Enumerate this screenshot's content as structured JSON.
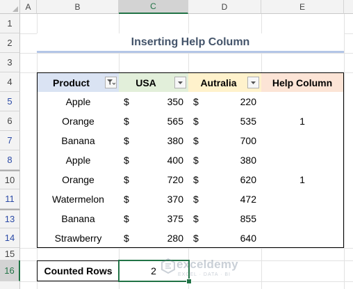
{
  "columns": [
    "A",
    "B",
    "C",
    "D",
    "E"
  ],
  "selected_column": "C",
  "rows": [
    "1",
    "2",
    "3",
    "4",
    "5",
    "6",
    "7",
    "8",
    "10",
    "11",
    "13",
    "14",
    "15",
    "16"
  ],
  "selected_row": "16",
  "title": "Inserting Help Column",
  "headers": {
    "product": "Product",
    "usa": "USA",
    "australia": "Autralia",
    "help": "Help Column"
  },
  "data_rows": [
    {
      "product": "Apple",
      "usa_cur": "$",
      "usa": "350",
      "aus_cur": "$",
      "aus": "220",
      "help": ""
    },
    {
      "product": "Orange",
      "usa_cur": "$",
      "usa": "565",
      "aus_cur": "$",
      "aus": "535",
      "help": "1"
    },
    {
      "product": "Banana",
      "usa_cur": "$",
      "usa": "380",
      "aus_cur": "$",
      "aus": "700",
      "help": ""
    },
    {
      "product": "Apple",
      "usa_cur": "$",
      "usa": "400",
      "aus_cur": "$",
      "aus": "380",
      "help": ""
    },
    {
      "product": "Orange",
      "usa_cur": "$",
      "usa": "720",
      "aus_cur": "$",
      "aus": "620",
      "help": "1"
    },
    {
      "product": "Watermelon",
      "usa_cur": "$",
      "usa": "370",
      "aus_cur": "$",
      "aus": "472",
      "help": ""
    },
    {
      "product": "Banana",
      "usa_cur": "$",
      "usa": "375",
      "aus_cur": "$",
      "aus": "855",
      "help": ""
    },
    {
      "product": "Strawberry",
      "usa_cur": "$",
      "usa": "280",
      "aus_cur": "$",
      "aus": "640",
      "help": ""
    }
  ],
  "counted": {
    "label": "Counted Rows",
    "value": "2"
  },
  "watermark": {
    "name": "exceldemy",
    "tagline": "EXCEL · DATA · BI"
  },
  "colors": {
    "product_header": "#dae3f3",
    "usa_header": "#e2efda",
    "australia_header": "#fff2cc",
    "help_header": "#fce4d6",
    "title_text": "#44546a",
    "title_underline": "#b4c6e7",
    "selection": "#217346"
  }
}
